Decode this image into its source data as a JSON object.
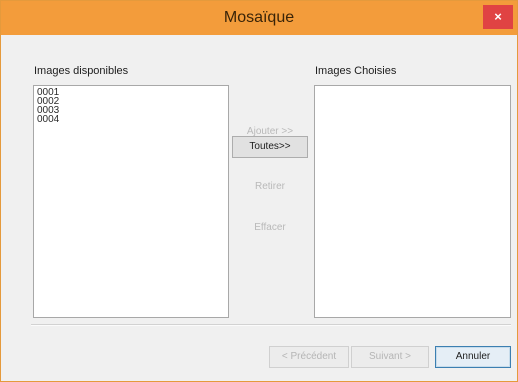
{
  "window": {
    "title": "Mosaïque",
    "close_glyph": "×",
    "accent_color": "#f39c3b"
  },
  "left_panel": {
    "label": "Images disponibles",
    "items": [
      "0001",
      "0002",
      "0003",
      "0004"
    ]
  },
  "right_panel": {
    "label": "Images Choisies",
    "items": []
  },
  "middle_buttons": {
    "add": "Ajouter >>",
    "all": "Toutes>>",
    "remove": "Retirer",
    "clear": "Effacer"
  },
  "footer_buttons": {
    "previous": "< Précédent",
    "next": "Suivant >",
    "cancel": "Annuler"
  }
}
